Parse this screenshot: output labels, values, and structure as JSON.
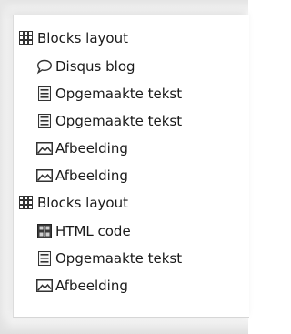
{
  "tree": {
    "items": [
      {
        "label": "Blocks layout",
        "icon": "grid-icon"
      },
      {
        "label": "Disqus blog",
        "icon": "speech-bubble-icon"
      },
      {
        "label": "Opgemaakte tekst",
        "icon": "formatted-text-icon"
      },
      {
        "label": "Opgemaakte tekst",
        "icon": "formatted-text-icon"
      },
      {
        "label": "Afbeelding",
        "icon": "image-icon"
      },
      {
        "label": "Afbeelding",
        "icon": "image-icon"
      },
      {
        "label": "Blocks layout",
        "icon": "grid-icon"
      },
      {
        "label": "HTML code",
        "icon": "html-code-icon"
      },
      {
        "label": "Opgemaakte tekst",
        "icon": "formatted-text-icon"
      },
      {
        "label": "Afbeelding",
        "icon": "image-icon"
      }
    ]
  }
}
